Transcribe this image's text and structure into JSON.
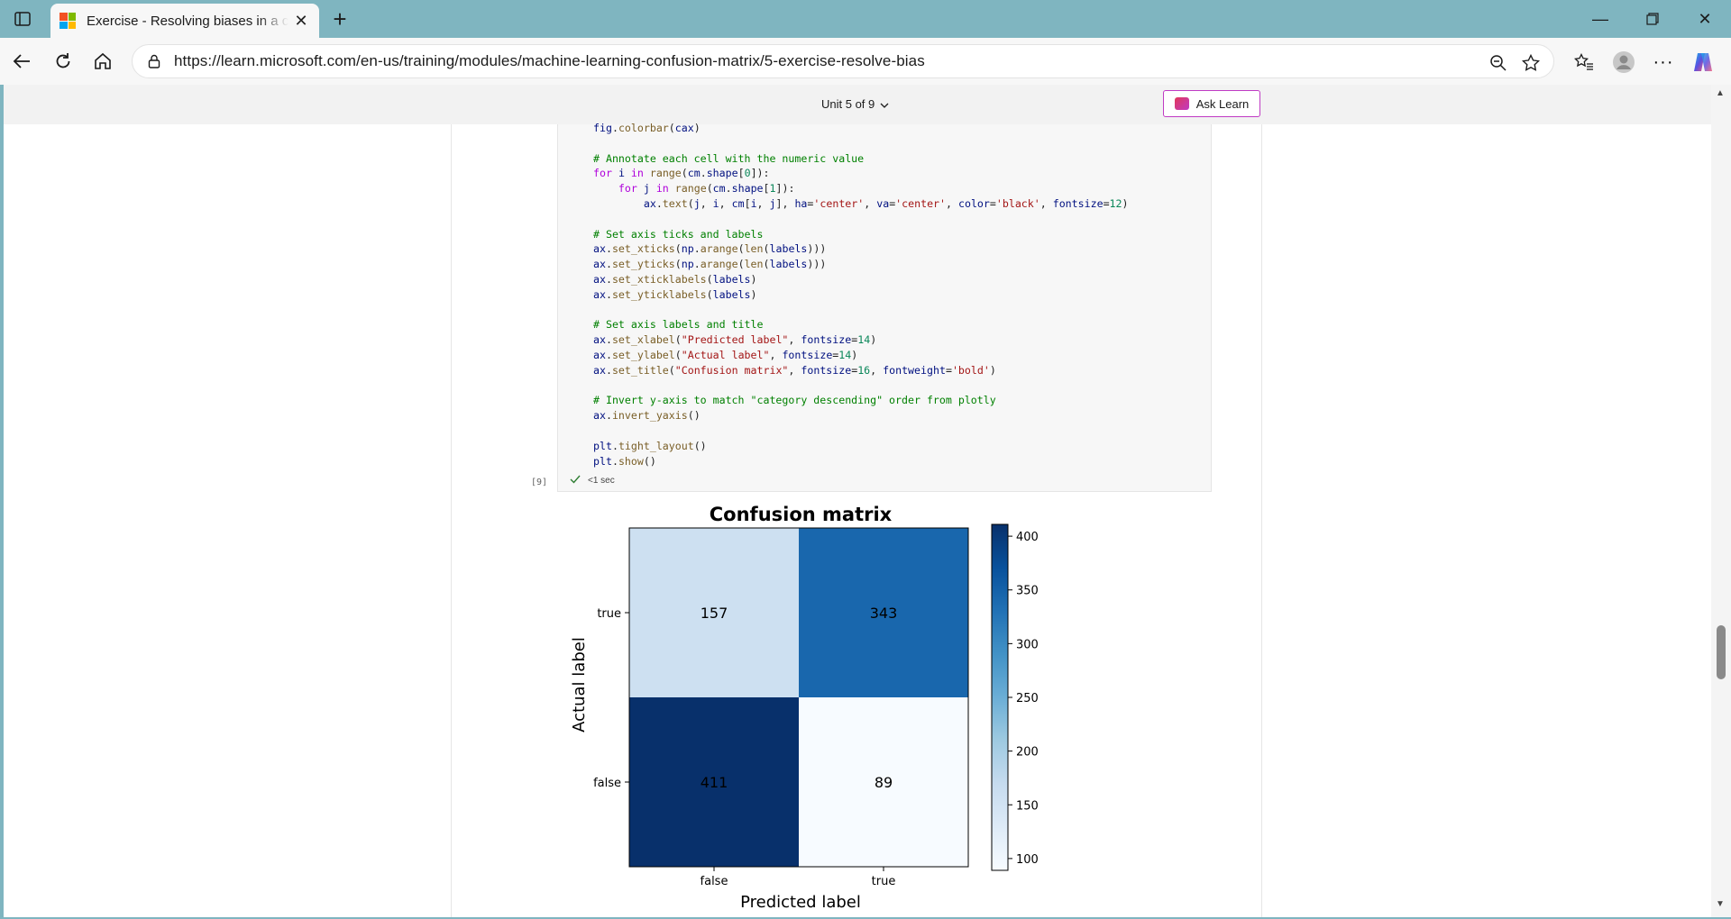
{
  "browser": {
    "tab_title": "Exercise - Resolving biases in a classification model",
    "url": "https://learn.microsoft.com/en-us/training/modules/machine-learning-confusion-matrix/5-exercise-resolve-bias",
    "new_tab_icon": "plus-icon",
    "close_tab_icon": "close-icon"
  },
  "page": {
    "unit_label": "Unit 5 of 9",
    "ask_learn_label": "Ask Learn"
  },
  "code_cell": {
    "lines": [
      [
        {
          "t": "fig",
          "c": "c-var"
        },
        {
          "t": "."
        },
        {
          "t": "colorbar",
          "c": "c-fn"
        },
        {
          "t": "("
        },
        {
          "t": "cax",
          "c": "c-var"
        },
        {
          "t": ")"
        }
      ],
      [],
      [
        {
          "t": "# Annotate each cell with the numeric value",
          "c": "c-com"
        }
      ],
      [
        {
          "t": "for",
          "c": "c-kw"
        },
        {
          "t": " "
        },
        {
          "t": "i",
          "c": "c-var"
        },
        {
          "t": " "
        },
        {
          "t": "in",
          "c": "c-kw"
        },
        {
          "t": " "
        },
        {
          "t": "range",
          "c": "c-fn"
        },
        {
          "t": "("
        },
        {
          "t": "cm",
          "c": "c-var"
        },
        {
          "t": "."
        },
        {
          "t": "shape",
          "c": "c-var"
        },
        {
          "t": "["
        },
        {
          "t": "0",
          "c": "c-num"
        },
        {
          "t": "]):"
        }
      ],
      [
        {
          "t": "    "
        },
        {
          "t": "for",
          "c": "c-kw"
        },
        {
          "t": " "
        },
        {
          "t": "j",
          "c": "c-var"
        },
        {
          "t": " "
        },
        {
          "t": "in",
          "c": "c-kw"
        },
        {
          "t": " "
        },
        {
          "t": "range",
          "c": "c-fn"
        },
        {
          "t": "("
        },
        {
          "t": "cm",
          "c": "c-var"
        },
        {
          "t": "."
        },
        {
          "t": "shape",
          "c": "c-var"
        },
        {
          "t": "["
        },
        {
          "t": "1",
          "c": "c-num"
        },
        {
          "t": "]):"
        }
      ],
      [
        {
          "t": "        "
        },
        {
          "t": "ax",
          "c": "c-var"
        },
        {
          "t": "."
        },
        {
          "t": "text",
          "c": "c-fn"
        },
        {
          "t": "("
        },
        {
          "t": "j",
          "c": "c-var"
        },
        {
          "t": ", "
        },
        {
          "t": "i",
          "c": "c-var"
        },
        {
          "t": ", "
        },
        {
          "t": "cm",
          "c": "c-var"
        },
        {
          "t": "["
        },
        {
          "t": "i",
          "c": "c-var"
        },
        {
          "t": ", "
        },
        {
          "t": "j",
          "c": "c-var"
        },
        {
          "t": "], "
        },
        {
          "t": "ha",
          "c": "c-var"
        },
        {
          "t": "="
        },
        {
          "t": "'center'",
          "c": "c-str"
        },
        {
          "t": ", "
        },
        {
          "t": "va",
          "c": "c-var"
        },
        {
          "t": "="
        },
        {
          "t": "'center'",
          "c": "c-str"
        },
        {
          "t": ", "
        },
        {
          "t": "color",
          "c": "c-var"
        },
        {
          "t": "="
        },
        {
          "t": "'black'",
          "c": "c-str"
        },
        {
          "t": ", "
        },
        {
          "t": "fontsize",
          "c": "c-var"
        },
        {
          "t": "="
        },
        {
          "t": "12",
          "c": "c-num"
        },
        {
          "t": ")"
        }
      ],
      [],
      [
        {
          "t": "# Set axis ticks and labels",
          "c": "c-com"
        }
      ],
      [
        {
          "t": "ax",
          "c": "c-var"
        },
        {
          "t": "."
        },
        {
          "t": "set_xticks",
          "c": "c-fn"
        },
        {
          "t": "("
        },
        {
          "t": "np",
          "c": "c-var"
        },
        {
          "t": "."
        },
        {
          "t": "arange",
          "c": "c-fn"
        },
        {
          "t": "("
        },
        {
          "t": "len",
          "c": "c-fn"
        },
        {
          "t": "("
        },
        {
          "t": "labels",
          "c": "c-var"
        },
        {
          "t": ")))"
        }
      ],
      [
        {
          "t": "ax",
          "c": "c-var"
        },
        {
          "t": "."
        },
        {
          "t": "set_yticks",
          "c": "c-fn"
        },
        {
          "t": "("
        },
        {
          "t": "np",
          "c": "c-var"
        },
        {
          "t": "."
        },
        {
          "t": "arange",
          "c": "c-fn"
        },
        {
          "t": "("
        },
        {
          "t": "len",
          "c": "c-fn"
        },
        {
          "t": "("
        },
        {
          "t": "labels",
          "c": "c-var"
        },
        {
          "t": ")))"
        }
      ],
      [
        {
          "t": "ax",
          "c": "c-var"
        },
        {
          "t": "."
        },
        {
          "t": "set_xticklabels",
          "c": "c-fn"
        },
        {
          "t": "("
        },
        {
          "t": "labels",
          "c": "c-var"
        },
        {
          "t": ")"
        }
      ],
      [
        {
          "t": "ax",
          "c": "c-var"
        },
        {
          "t": "."
        },
        {
          "t": "set_yticklabels",
          "c": "c-fn"
        },
        {
          "t": "("
        },
        {
          "t": "labels",
          "c": "c-var"
        },
        {
          "t": ")"
        }
      ],
      [],
      [
        {
          "t": "# Set axis labels and title",
          "c": "c-com"
        }
      ],
      [
        {
          "t": "ax",
          "c": "c-var"
        },
        {
          "t": "."
        },
        {
          "t": "set_xlabel",
          "c": "c-fn"
        },
        {
          "t": "("
        },
        {
          "t": "\"Predicted label\"",
          "c": "c-str"
        },
        {
          "t": ", "
        },
        {
          "t": "fontsize",
          "c": "c-var"
        },
        {
          "t": "="
        },
        {
          "t": "14",
          "c": "c-num"
        },
        {
          "t": ")"
        }
      ],
      [
        {
          "t": "ax",
          "c": "c-var"
        },
        {
          "t": "."
        },
        {
          "t": "set_ylabel",
          "c": "c-fn"
        },
        {
          "t": "("
        },
        {
          "t": "\"Actual label\"",
          "c": "c-str"
        },
        {
          "t": ", "
        },
        {
          "t": "fontsize",
          "c": "c-var"
        },
        {
          "t": "="
        },
        {
          "t": "14",
          "c": "c-num"
        },
        {
          "t": ")"
        }
      ],
      [
        {
          "t": "ax",
          "c": "c-var"
        },
        {
          "t": "."
        },
        {
          "t": "set_title",
          "c": "c-fn"
        },
        {
          "t": "("
        },
        {
          "t": "\"Confusion matrix\"",
          "c": "c-str"
        },
        {
          "t": ", "
        },
        {
          "t": "fontsize",
          "c": "c-var"
        },
        {
          "t": "="
        },
        {
          "t": "16",
          "c": "c-num"
        },
        {
          "t": ", "
        },
        {
          "t": "fontweight",
          "c": "c-var"
        },
        {
          "t": "="
        },
        {
          "t": "'bold'",
          "c": "c-str"
        },
        {
          "t": ")"
        }
      ],
      [],
      [
        {
          "t": "# Invert y-axis to match \"category descending\" order from plotly",
          "c": "c-com"
        }
      ],
      [
        {
          "t": "ax",
          "c": "c-var"
        },
        {
          "t": "."
        },
        {
          "t": "invert_yaxis",
          "c": "c-fn"
        },
        {
          "t": "()"
        }
      ],
      [],
      [
        {
          "t": "plt",
          "c": "c-var"
        },
        {
          "t": "."
        },
        {
          "t": "tight_layout",
          "c": "c-fn"
        },
        {
          "t": "()"
        }
      ],
      [
        {
          "t": "plt",
          "c": "c-var"
        },
        {
          "t": "."
        },
        {
          "t": "show",
          "c": "c-fn"
        },
        {
          "t": "()"
        }
      ]
    ],
    "exec_count": "[9]",
    "exec_time": "<1 sec"
  },
  "chart_data": {
    "type": "heatmap",
    "title": "Confusion matrix",
    "xlabel": "Predicted label",
    "ylabel": "Actual label",
    "x_categories": [
      "false",
      "true"
    ],
    "y_categories": [
      "true",
      "false"
    ],
    "values": [
      [
        157,
        343
      ],
      [
        411,
        89
      ]
    ],
    "colormap": "Blues",
    "colorbar": {
      "min": 89,
      "max": 411,
      "ticks": [
        100,
        150,
        200,
        250,
        300,
        350,
        400
      ]
    }
  }
}
